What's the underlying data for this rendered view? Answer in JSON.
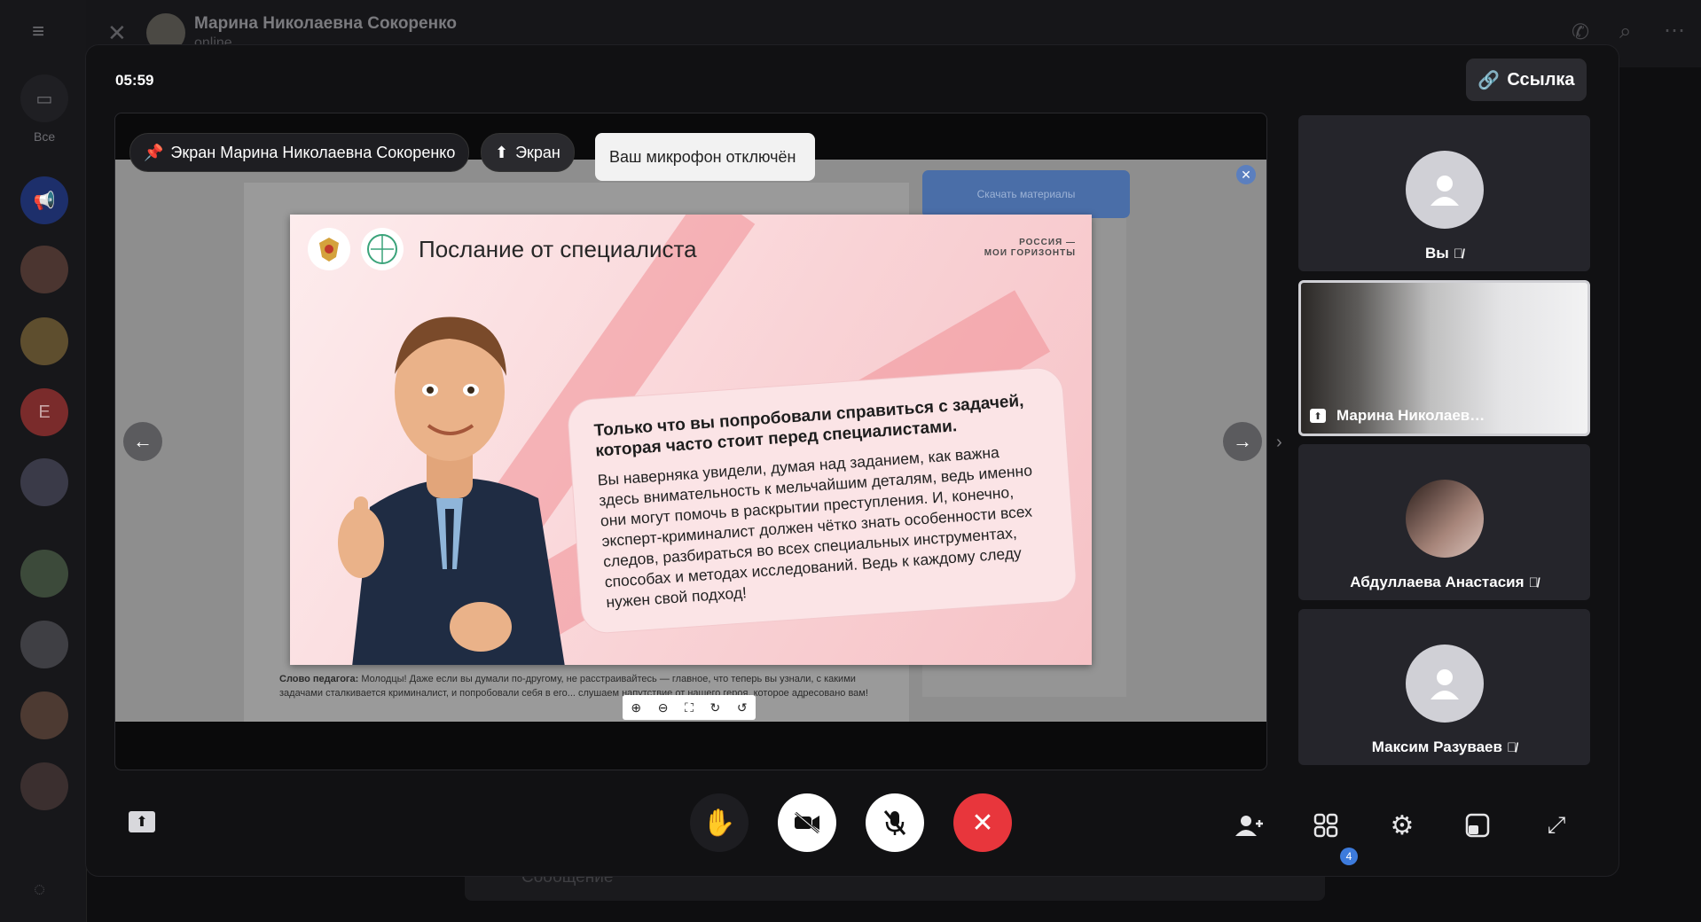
{
  "background": {
    "sidebar": {
      "label_all": "Все",
      "avatar_letter": "E"
    },
    "chat": {
      "contact_name": "Марина Николаевна Сокоренко",
      "status": "online"
    },
    "composer": {
      "placeholder": "Сообщение"
    }
  },
  "call": {
    "timer": "05:59",
    "link_button": "Ссылка",
    "pinned_label": "Экран Марина Николаевна Сокоренко",
    "screen_label": "Экран",
    "mic_tooltip": "Ваш микрофон отключён",
    "participants_count": "4"
  },
  "shared_screen": {
    "download_button": "Скачать материалы",
    "slide": {
      "title": "Послание от специалиста",
      "brand_line1": "РОССИЯ —",
      "brand_line2": "МОИ ГОРИЗОНТЫ",
      "bubble_heading": "Только что вы попробовали справиться с задачей, которая часто стоит перед специалистами.",
      "bubble_text": "Вы наверняка увидели, думая над заданием, как важна здесь внимательность к мельчайшим деталям, ведь именно они могут помочь в раскрытии преступления. И, конечно, эксперт-криминалист должен чётко знать особенности всех следов, разбираться во всех специальных инструментах, способах и методах исследований. Ведь к каждому следу нужен свой подход!"
    },
    "doc_footer_label": "Слово педагога:",
    "doc_footer_text": "Молодцы! Даже если вы думали по-другому, не расстраивайтесь — главное, что теперь вы узнали, с какими задачами сталкивается криминалист, и попробовали себя в его... слушаем напутствие от нашего героя, которое адресовано вам!"
  },
  "participants": [
    {
      "name": "Вы",
      "muted": true
    },
    {
      "name": "Марина Николаев…",
      "sharing": true
    },
    {
      "name": "Абдуллаева Анастасия",
      "muted": true
    },
    {
      "name": "Максим Разуваев",
      "muted": true
    }
  ],
  "colors": {
    "hangup": "#e8363c",
    "accent": "#3d7bdc",
    "panel": "#111113"
  }
}
